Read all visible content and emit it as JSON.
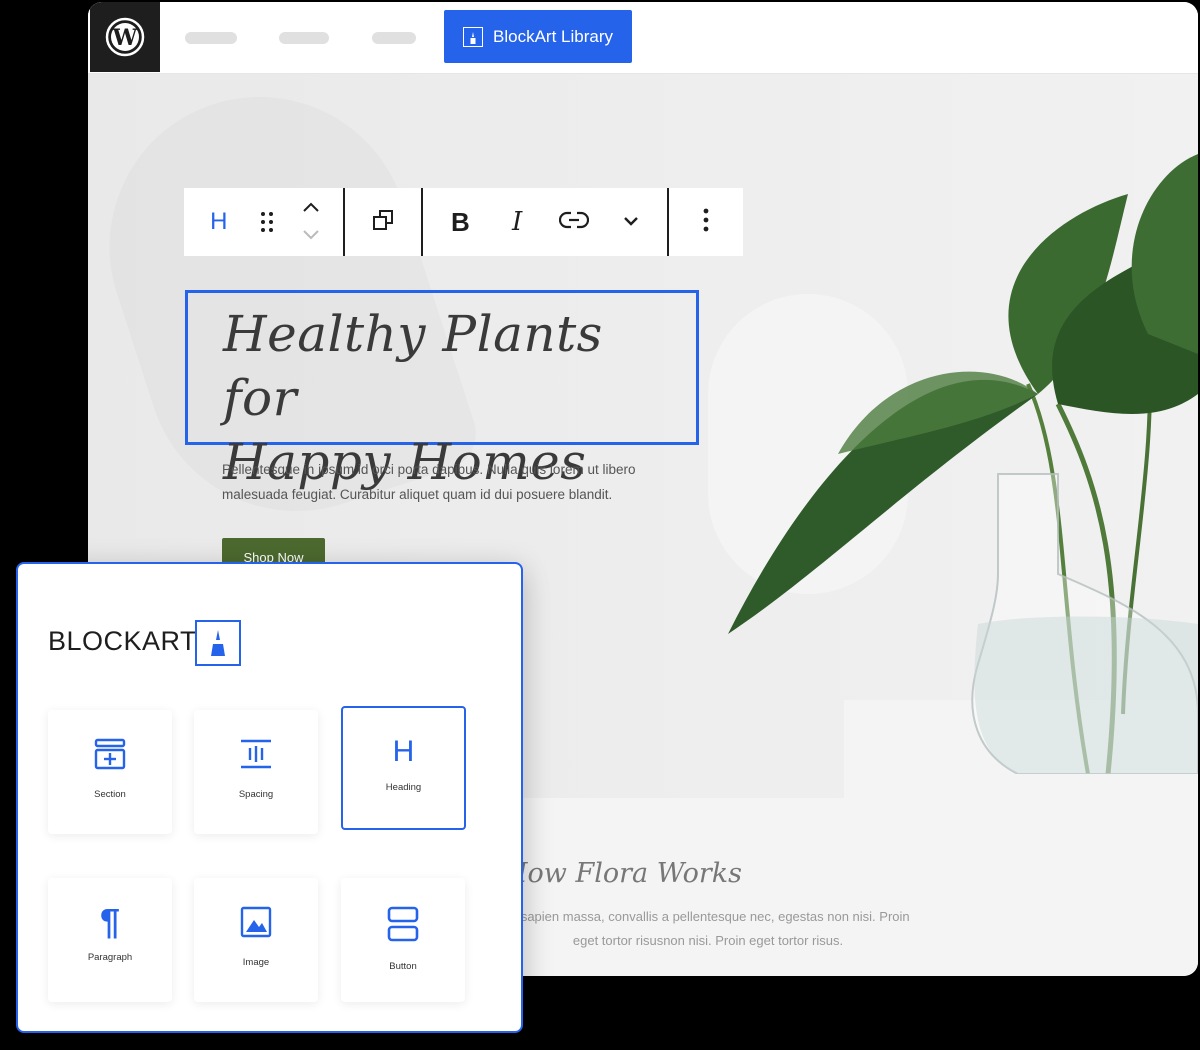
{
  "topbar": {
    "library_button": "BlockArt Library"
  },
  "toolbar": {
    "block_type": "H"
  },
  "hero": {
    "heading_line1": "Healthy Plants for",
    "heading_line2": "Happy Homes",
    "description_line1": "Pellentesque in ipsum id orci porta dapibus. Nulla quis lorem ut libero",
    "description_line2": "malesuada feugiat. Curabitur aliquet quam id dui posuere blandit.",
    "cta": "Shop Now"
  },
  "section2": {
    "title": "How Flora Works",
    "text_line1": "nt sapien massa, convallis a pellentesque nec, egestas non nisi. Proin",
    "text_line2": "eget tortor risusnon nisi. Proin eget tortor risus."
  },
  "panel": {
    "title": "BLOCKART",
    "blocks": [
      {
        "label": "Section",
        "icon": "section-icon"
      },
      {
        "label": "Spacing",
        "icon": "spacing-icon"
      },
      {
        "label": "Heading",
        "icon": "heading-icon",
        "active": true
      },
      {
        "label": "Paragraph",
        "icon": "paragraph-icon"
      },
      {
        "label": "Image",
        "icon": "image-icon"
      },
      {
        "label": "Button",
        "icon": "button-icon"
      }
    ]
  },
  "colors": {
    "accent": "#2563eb",
    "cta": "#4c6a2f",
    "wp_logo_bg": "#1e1e1e"
  }
}
